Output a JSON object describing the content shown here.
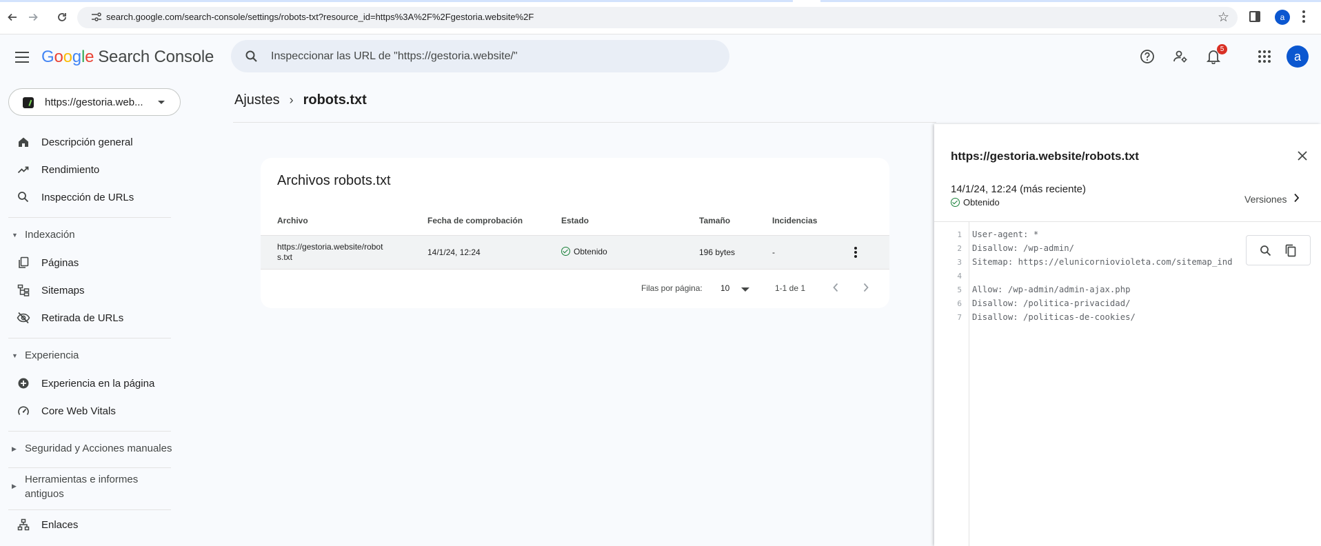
{
  "browser": {
    "url": "search.google.com/search-console/settings/robots-txt?resource_id=https%3A%2F%2Fgestoria.website%2F",
    "profile_initial": "a"
  },
  "header": {
    "logo_letters": [
      "G",
      "o",
      "o",
      "g",
      "l",
      "e"
    ],
    "product_name": "Search Console",
    "search_placeholder": "Inspeccionar las URL de \"https://gestoria.website/\"",
    "notification_count": "5",
    "user_initial": "a"
  },
  "sidebar": {
    "property": "https://gestoria.web...",
    "items": [
      {
        "label": "Descripción general",
        "icon": "home-icon"
      },
      {
        "label": "Rendimiento",
        "icon": "trending-up-icon"
      },
      {
        "label": "Inspección de URLs",
        "icon": "search-icon"
      }
    ],
    "indexacion": {
      "title": "Indexación",
      "items": [
        {
          "label": "Páginas",
          "icon": "pages-icon"
        },
        {
          "label": "Sitemaps",
          "icon": "sitemap-icon"
        },
        {
          "label": "Retirada de URLs",
          "icon": "visibility-off-icon"
        }
      ]
    },
    "experiencia": {
      "title": "Experiencia",
      "items": [
        {
          "label": "Experiencia en la página",
          "icon": "add-circle-icon"
        },
        {
          "label": "Core Web Vitals",
          "icon": "speed-icon"
        }
      ]
    },
    "seguridad_title": "Seguridad y Acciones manuales",
    "herramientas_title": [
      "Herramientas e informes",
      "antiguos"
    ],
    "enlaces": {
      "label": "Enlaces",
      "icon": "links-icon"
    }
  },
  "breadcrumb": {
    "parent": "Ajustes",
    "current": "robots.txt"
  },
  "card": {
    "title": "Archivos robots.txt",
    "columns": [
      "Archivo",
      "Fecha de comprobación",
      "Estado",
      "Tamaño",
      "Incidencias"
    ],
    "row": {
      "file_line1": "https://gestoria.website/robot",
      "file_line2": "s.txt",
      "date": "14/1/24, 12:24",
      "status": "Obtenido",
      "size": "196 bytes",
      "issues": "-"
    },
    "pagination": {
      "rows_per_page_label": "Filas por página:",
      "rows_per_page": "10",
      "range": "1-1 de 1"
    }
  },
  "panel": {
    "title": "https://gestoria.website/robots.txt",
    "date": "14/1/24, 12:24 (más reciente)",
    "status": "Obtenido",
    "versions_label": "Versiones",
    "lines": [
      {
        "n": "1",
        "text": "User-agent: *"
      },
      {
        "n": "2",
        "text": "Disallow: /wp-admin/"
      },
      {
        "n": "3",
        "text": "Sitemap: https://elunicorniovioleta.com/sitemap_ind"
      },
      {
        "n": "4",
        "text": ""
      },
      {
        "n": "5",
        "text": "Allow: /wp-admin/admin-ajax.php"
      },
      {
        "n": "6",
        "text": "Disallow: /politica-privacidad/"
      },
      {
        "n": "7",
        "text": "Disallow: /politicas-de-cookies/"
      }
    ]
  },
  "colors": {
    "accent": "#0b57d0",
    "success": "#188038",
    "badge": "#d93025"
  }
}
